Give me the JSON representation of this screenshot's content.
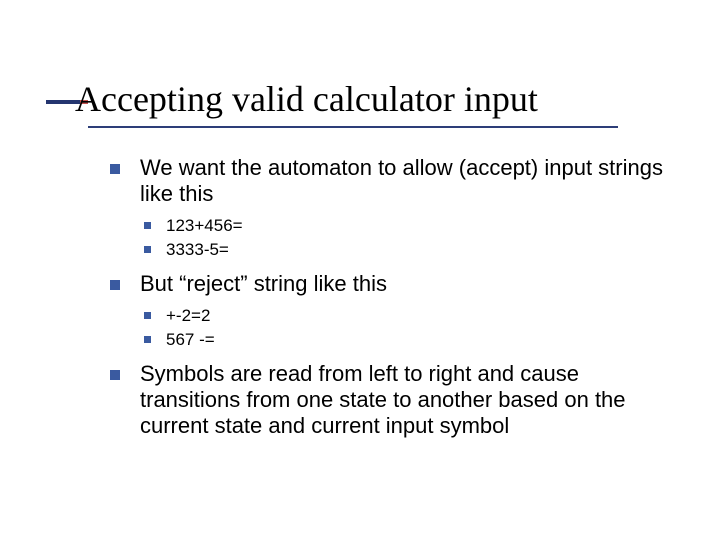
{
  "title": "Accepting valid calculator input",
  "bullets": [
    {
      "text": "We want the automaton to allow (accept) input strings like this",
      "sub": [
        "123+456=",
        "3333-5="
      ]
    },
    {
      "text": "But “reject” string like this",
      "sub": [
        "+-2=2",
        "567 -="
      ]
    },
    {
      "text": "Symbols are read from left to right and cause transitions from one state to another based on the current state and current input symbol",
      "sub": []
    }
  ]
}
